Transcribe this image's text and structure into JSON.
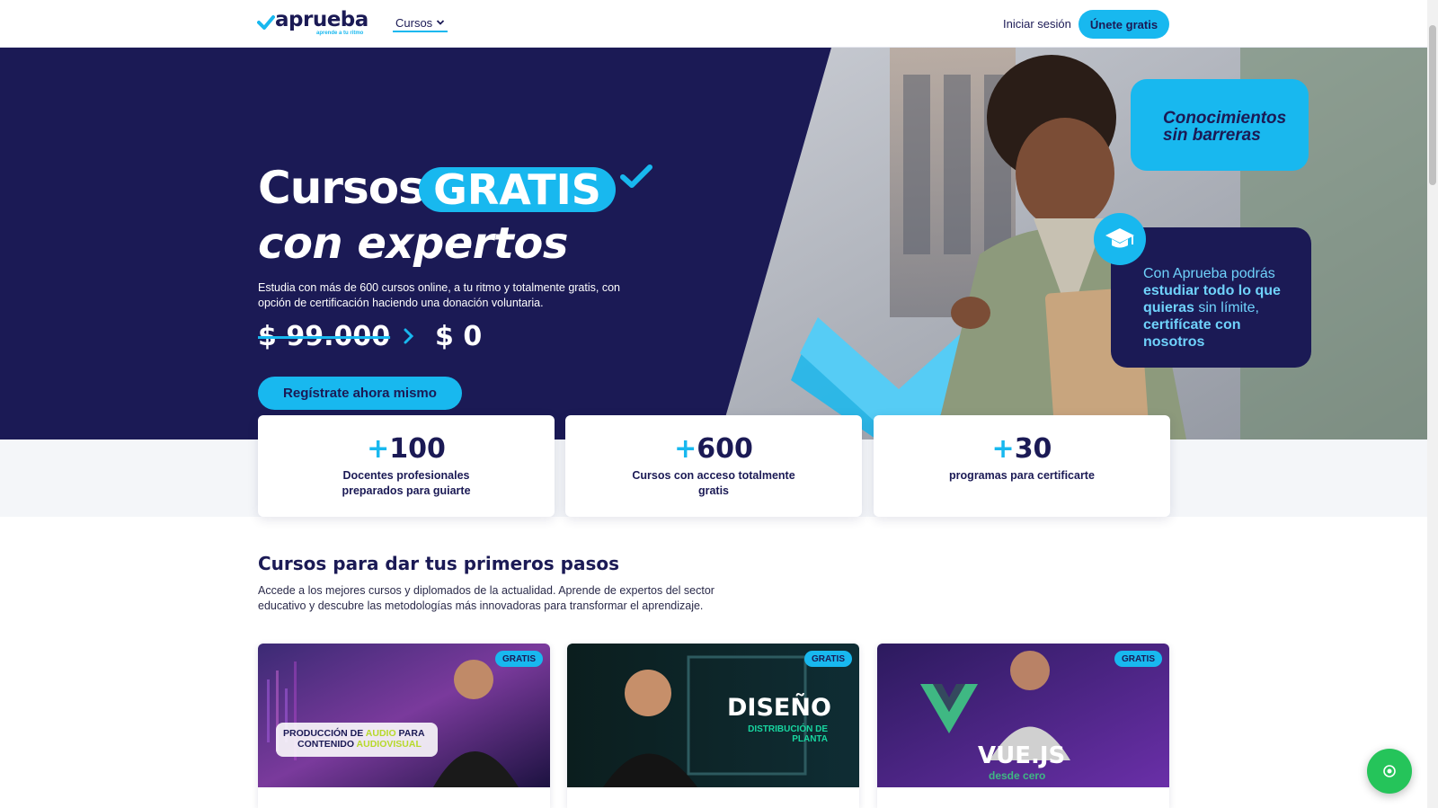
{
  "header": {
    "logo_text": "aprueba",
    "logo_tagline": "aprende a tu ritmo",
    "nav_courses": "Cursos",
    "login_label": "Iniciar sesión",
    "join_label": "Únete gratis"
  },
  "hero": {
    "title_part1": "Cursos",
    "title_highlight": "GRATIS",
    "title_part2": "con expertos",
    "description": "Estudia con más de 600 cursos online, a tu ritmo y totalmente gratis, con opción de certificación haciendo una donación voluntaria.",
    "price_old": "$ 99.000",
    "price_new": "$ 0",
    "cta_label": "Regístrate ahora mismo",
    "bubble_1": "Conocimientos sin barreras",
    "bubble_2_a": "Con Aprueba podrás ",
    "bubble_2_b": "estudiar todo lo que quieras",
    "bubble_2_c": " sin límite, ",
    "bubble_2_d": "certifícate con nosotros"
  },
  "stats": [
    {
      "plus": "+",
      "value": "100",
      "label": "Docentes profesionales preparados para guiarte"
    },
    {
      "plus": "+",
      "value": "600",
      "label": "Cursos con acceso totalmente gratis"
    },
    {
      "plus": "+",
      "value": "30",
      "label": "programas para certificarte"
    }
  ],
  "section": {
    "title": "Cursos para dar tus primeros pasos",
    "description": "Accede a los mejores cursos y diplomados de la actualidad. Aprende de expertos del sector educativo y descubre las metodologías más innovadoras para transformar el aprendizaje."
  },
  "courses": [
    {
      "badge": "GRATIS",
      "thumb_line1_a": "PRODUCCIÓN DE ",
      "thumb_line1_b": "AUDIO",
      "thumb_line1_c": " PARA",
      "thumb_line2_a": "CONTENIDO ",
      "thumb_line2_b": "AUDIOVISUAL"
    },
    {
      "badge": "GRATIS",
      "thumb_title": "DISEÑO",
      "thumb_sub1": "DISTRIBUCIÓN DE",
      "thumb_sub2": "PLANTA"
    },
    {
      "badge": "GRATIS",
      "thumb_title": "VUE.JS",
      "thumb_sub": "desde cero"
    }
  ],
  "colors": {
    "navy": "#1b1a55",
    "accent": "#18b8ef",
    "whatsapp": "#25c45a"
  },
  "icons": [
    "check-icon",
    "chevron-down-icon",
    "chevron-right-icon",
    "graduation-cap-icon",
    "whatsapp-icon"
  ]
}
